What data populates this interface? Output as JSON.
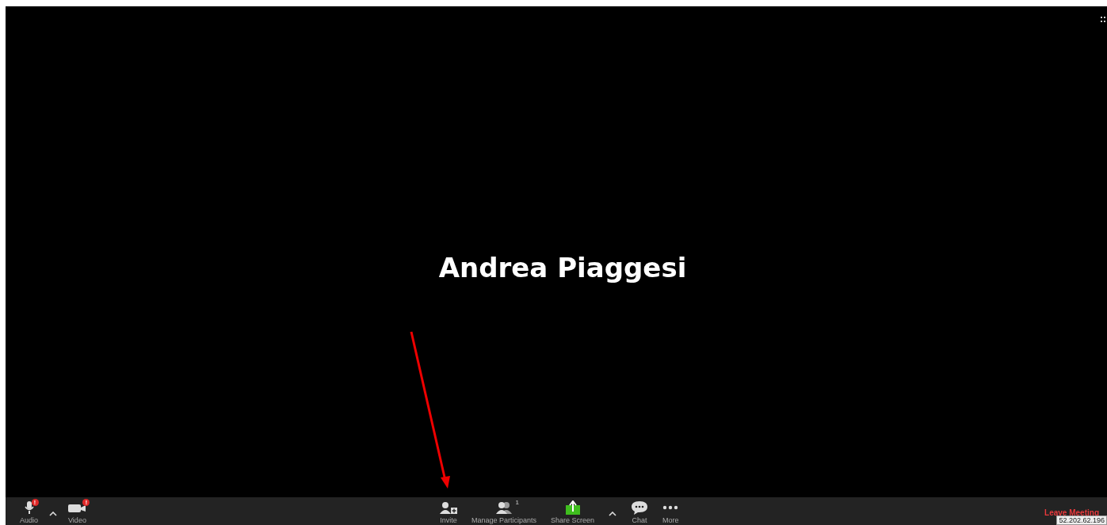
{
  "video": {
    "participant_name": "Andrea Piaggesi"
  },
  "toolbar": {
    "left": [
      {
        "kind": "audio",
        "label": "Audio",
        "badge": "!"
      },
      {
        "kind": "caret"
      },
      {
        "kind": "video",
        "label": "Video",
        "badge": "!"
      }
    ],
    "center": [
      {
        "kind": "invite",
        "label": "Invite"
      },
      {
        "kind": "participants",
        "label": "Manage Participants",
        "count": "1"
      },
      {
        "kind": "share",
        "label": "Share Screen"
      },
      {
        "kind": "caret"
      },
      {
        "kind": "chat",
        "label": "Chat"
      },
      {
        "kind": "more",
        "label": "More"
      }
    ],
    "leave": {
      "label": "Leave Meeting"
    },
    "ip_tooltip": "52.202.62.196"
  }
}
